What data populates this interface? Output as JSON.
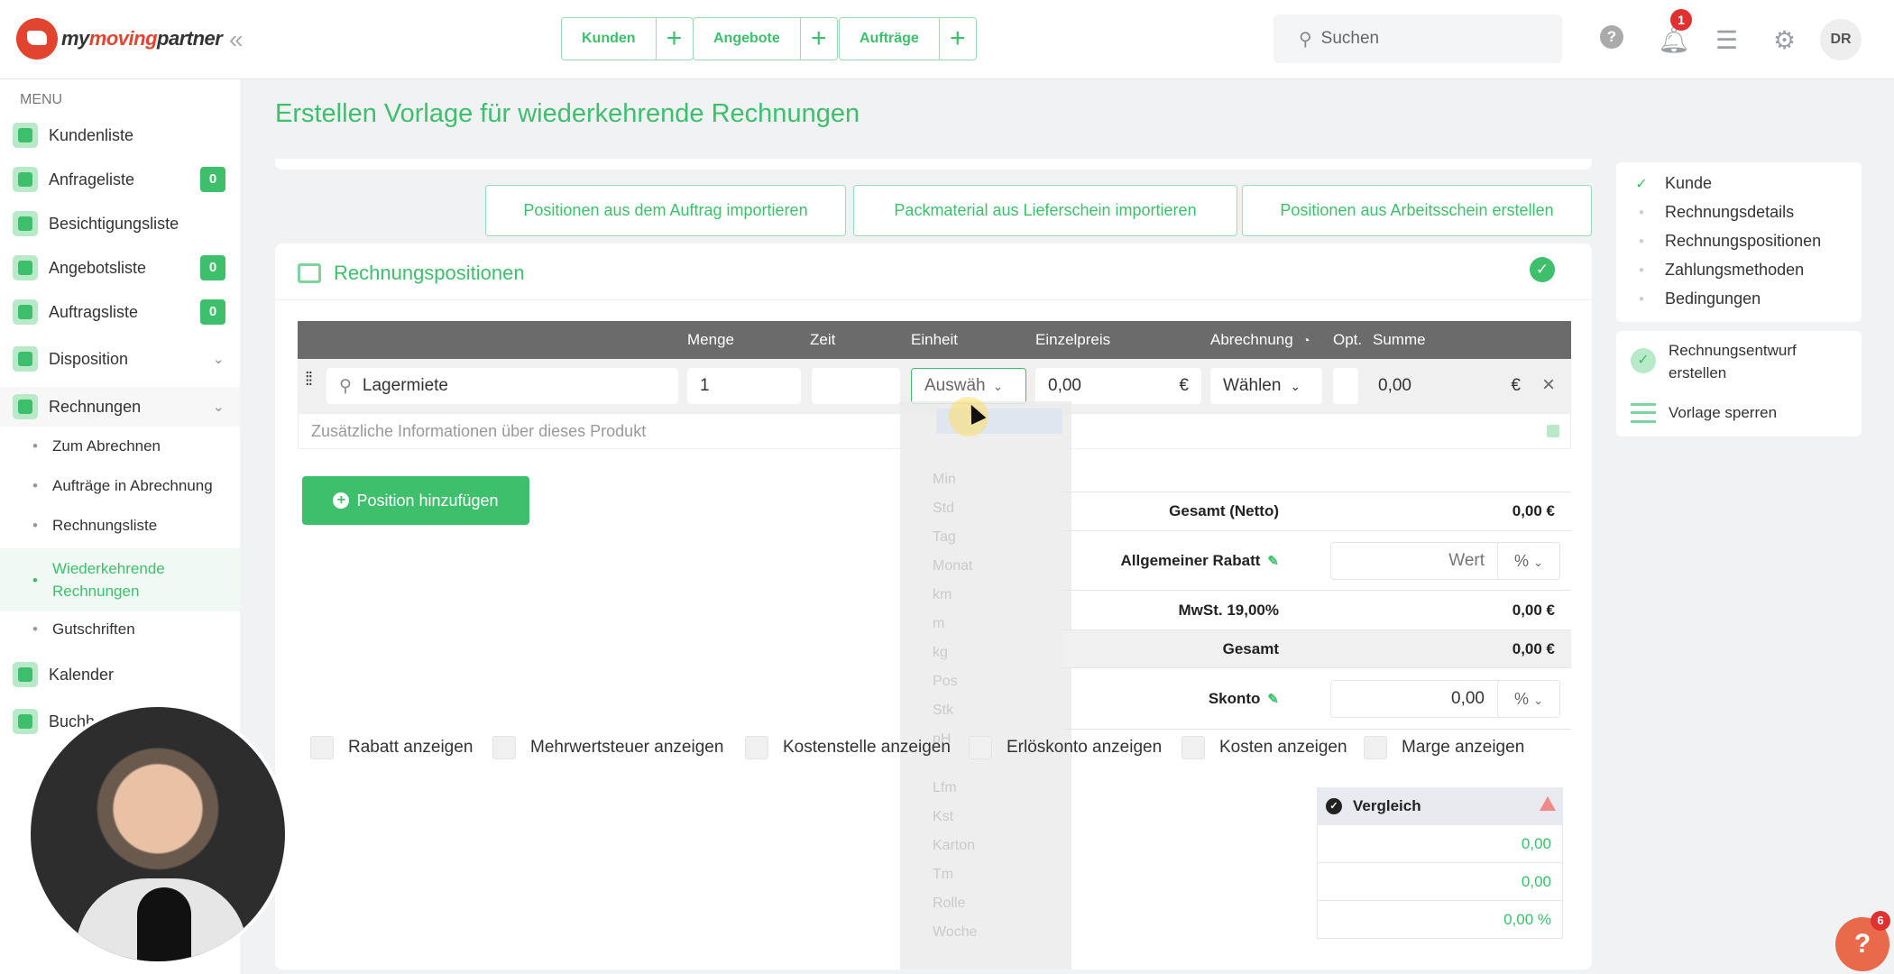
{
  "topbar": {
    "logo": {
      "prefix": "my",
      "brand": "moving",
      "suffix": "partner"
    },
    "quick_actions": [
      {
        "label": "Kunden"
      },
      {
        "label": "Angebote"
      },
      {
        "label": "Aufträge"
      }
    ],
    "plus": "+",
    "search_placeholder": "Suchen",
    "help": "?",
    "notification_count": "1",
    "avatar_initials": "DR"
  },
  "sidebar": {
    "menu_title": "MENU",
    "items": [
      {
        "label": "Kundenliste"
      },
      {
        "label": "Anfrageliste",
        "badge": "0"
      },
      {
        "label": "Besichtigungsliste"
      },
      {
        "label": "Angebotsliste",
        "badge": "0"
      },
      {
        "label": "Auftragsliste",
        "badge": "0"
      },
      {
        "label": "Disposition"
      },
      {
        "label": "Rechnungen"
      },
      {
        "label": "Kalender"
      },
      {
        "label": "Buchh"
      }
    ],
    "sub_items": [
      {
        "label": "Zum Abrechnen"
      },
      {
        "label": "Aufträge in Abrechnung"
      },
      {
        "label": "Rechnungsliste"
      },
      {
        "label": "Wiederkehrende Rechnungen"
      },
      {
        "label": "Gutschriften"
      }
    ]
  },
  "page": {
    "title": "Erstellen Vorlage für wiederkehrende Rechnungen",
    "import_buttons": [
      {
        "label": "Positionen aus dem Auftrag importieren"
      },
      {
        "label": "Packmaterial aus Lieferschein importieren"
      },
      {
        "label": "Positionen aus Arbeitsschein erstellen"
      }
    ],
    "section_title": "Rechnungspositionen",
    "table_headers": [
      "Menge",
      "Zeit",
      "Einheit",
      "Einzelpreis",
      "Abrechnung",
      "Opt.",
      "Summe"
    ],
    "row": {
      "product": "Lagermiete",
      "menge": "1",
      "zeit": "",
      "einheit": "Auswäh",
      "einzelpreis": "0,00",
      "currency": "€",
      "abrechnung": "Wählen",
      "summe": "0,00",
      "info_placeholder": "Zusätzliche Informationen über dieses Produkt"
    },
    "unit_dropdown_options": [
      "Min",
      "Std",
      "Tag",
      "Monat",
      "km",
      "m",
      "kg",
      "Pos",
      "Stk",
      "pH",
      "Lfm",
      "Kst",
      "Karton",
      "Tm",
      "Rolle",
      "Woche"
    ],
    "add_position": "Position hinzufügen",
    "totals": {
      "netto_label": "Gesamt (Netto)",
      "netto_value": "0,00 €",
      "rabatt_label": "Allgemeiner Rabatt",
      "rabatt_placeholder": "Wert",
      "rabatt_unit": "%",
      "mwst_label": "MwSt. 19,00%",
      "mwst_value": "0,00 €",
      "gesamt_label": "Gesamt",
      "gesamt_value": "0,00 €",
      "skonto_label": "Skonto",
      "skonto_value": "0,00",
      "skonto_unit": "%"
    },
    "options": [
      {
        "label": "Rabatt anzeigen"
      },
      {
        "label": "Mehrwertsteuer anzeigen"
      },
      {
        "label": "Kostenstelle anzeigen"
      },
      {
        "label": "Erlöskonto anzeigen"
      },
      {
        "label": "Kosten anzeigen"
      },
      {
        "label": "Marge anzeigen"
      }
    ],
    "comparison": {
      "title": "Vergleich",
      "values": [
        "0,00",
        "0,00",
        "0,00 %"
      ]
    }
  },
  "right_panel": {
    "steps": [
      {
        "label": "Kunde",
        "done": true
      },
      {
        "label": "Rechnungsdetails"
      },
      {
        "label": "Rechnungspositionen"
      },
      {
        "label": "Zahlungsmethoden"
      },
      {
        "label": "Bedingungen"
      }
    ],
    "draft_action": "Rechnungsentwurf erstellen",
    "lock_action": "Vorlage sperren"
  },
  "help_fab": {
    "label": "?",
    "badge": "6"
  },
  "colors": {
    "accent": "#3dbf6b",
    "header_gray": "#6b6b6b",
    "badge_red": "#e03131"
  }
}
